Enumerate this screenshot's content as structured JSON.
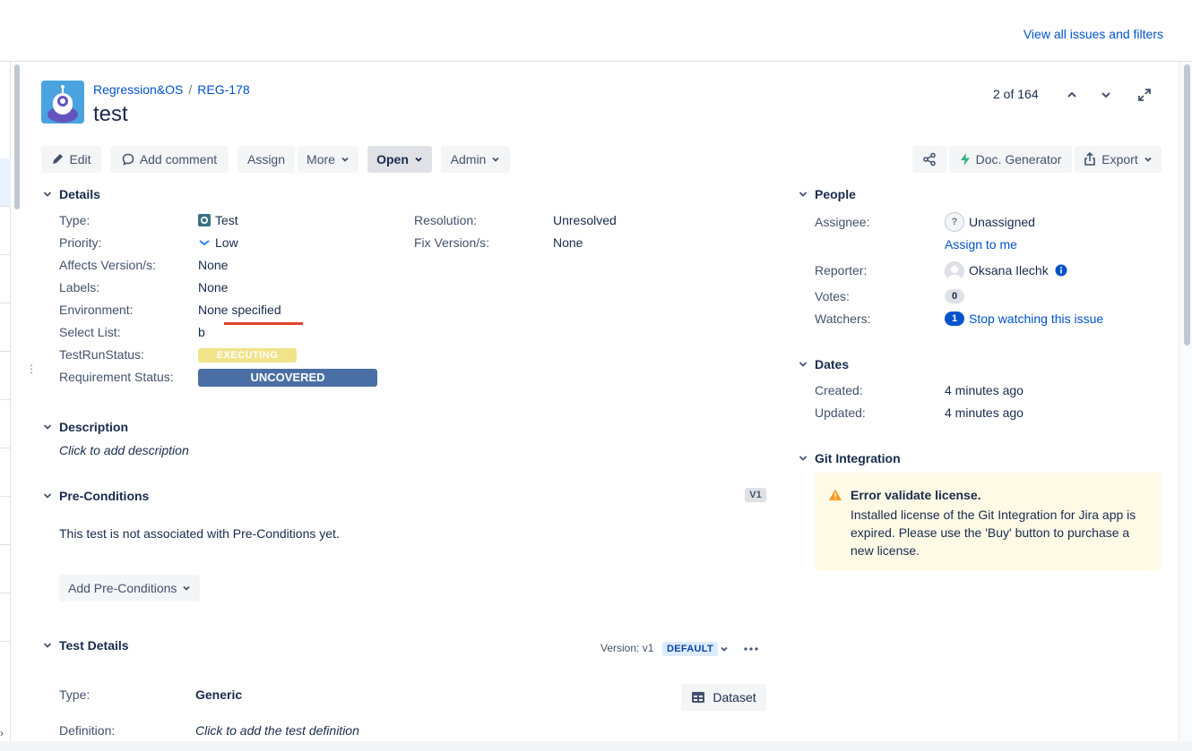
{
  "header": {
    "view_all": "View all issues and filters"
  },
  "breadcrumb": {
    "project": "Regression&OS",
    "separator": "/",
    "issue_key": "REG-178"
  },
  "issue": {
    "title": "test"
  },
  "pager": {
    "text": "2 of 164"
  },
  "toolbar": {
    "edit": "Edit",
    "add_comment": "Add comment",
    "assign": "Assign",
    "more": "More",
    "open": "Open",
    "admin": "Admin",
    "doc_generator": "Doc. Generator",
    "export": "Export"
  },
  "details": {
    "title": "Details",
    "type_label": "Type:",
    "type_value": "Test",
    "priority_label": "Priority:",
    "priority_value": "Low",
    "affects_label": "Affects Version/s:",
    "affects_value": "None",
    "labels_label": "Labels:",
    "labels_value": "None",
    "environment_label": "Environment:",
    "environment_value": "None specified",
    "select_list_label": "Select List:",
    "select_list_value": "b",
    "testrun_label": "TestRunStatus:",
    "testrun_value": "EXECUTING",
    "req_status_label": "Requirement Status:",
    "req_status_value": "UNCOVERED",
    "resolution_label": "Resolution:",
    "resolution_value": "Unresolved",
    "fix_label": "Fix Version/s:",
    "fix_value": "None",
    "colors": {
      "executing": "#f0e38a",
      "uncovered": "#4a6fa5",
      "underline": "#e0452b"
    }
  },
  "description": {
    "title": "Description",
    "placeholder": "Click to add description"
  },
  "preconditions": {
    "title": "Pre-Conditions",
    "badge": "V1",
    "message": "This test is not associated with Pre-Conditions yet.",
    "add_button": "Add Pre-Conditions"
  },
  "test_details": {
    "title": "Test Details",
    "version_label": "Version: v1",
    "default_badge": "DEFAULT",
    "type_label": "Type:",
    "type_value": "Generic",
    "definition_label": "Definition:",
    "definition_value": "Click to add the test definition",
    "dataset_button": "Dataset"
  },
  "people": {
    "title": "People",
    "assignee_label": "Assignee:",
    "assignee_value": "Unassigned",
    "assign_to_me": "Assign to me",
    "reporter_label": "Reporter:",
    "reporter_value": "Oksana Ilechk",
    "votes_label": "Votes:",
    "votes_value": "0",
    "watchers_label": "Watchers:",
    "watchers_count": "1",
    "watchers_action": "Stop watching this issue"
  },
  "dates": {
    "title": "Dates",
    "created_label": "Created:",
    "created_value": "4 minutes ago",
    "updated_label": "Updated:",
    "updated_value": "4 minutes ago"
  },
  "git": {
    "title": "Git Integration",
    "error_title": "Error validate license.",
    "error_message": "Installed license of the Git Integration for Jira app is expired. Please use the 'Buy' button to purchase a new license."
  },
  "icons": {
    "edit": "pencil-icon",
    "comment": "comment-icon",
    "share": "share-icon",
    "bolt": "bolt-icon",
    "export": "export-icon",
    "chevron": "chevron-down-icon",
    "up": "chevron-up-icon",
    "expand": "expand-icon",
    "warning": "warning-icon",
    "info": "info-icon",
    "more": "more-icon",
    "table": "table-icon",
    "test_type": "test-type-icon",
    "priority_low": "priority-low-icon"
  }
}
